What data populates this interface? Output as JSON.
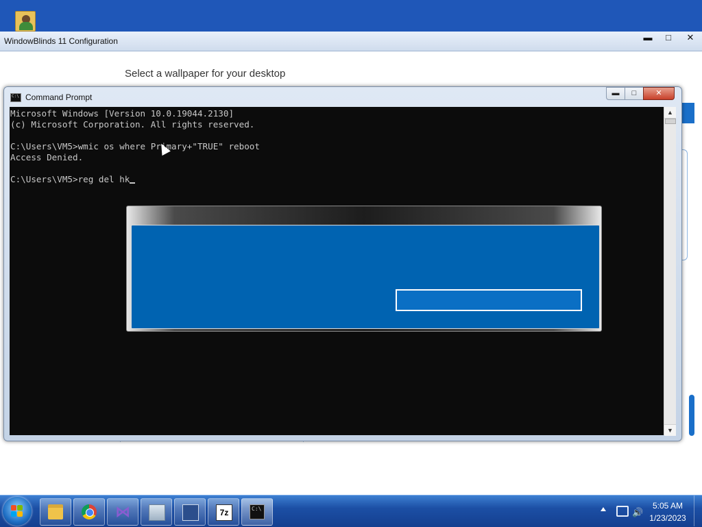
{
  "wb_window": {
    "title": "WindowBlinds 11 Configuration",
    "subtitle": "Select a wallpaper for your desktop",
    "minimize": "▬",
    "maximize": "□",
    "close": "✕"
  },
  "cmd_window": {
    "title": "Command Prompt",
    "minimize": "▬",
    "maximize": "□",
    "close": "✕",
    "lines": [
      "Microsoft Windows [Version 10.0.19044.2130]",
      "(c) Microsoft Corporation. All rights reserved.",
      "",
      "C:\\Users\\VM5>wmic os where Primary+\"TRUE\" reboot",
      "Access Denied.",
      "",
      "C:\\Users\\VM5>reg del hk"
    ]
  },
  "scroll": {
    "up": "▲",
    "down": "▼"
  },
  "taskbar": {
    "icons": [
      "start-orb",
      "file-explorer",
      "chrome",
      "visual-studio",
      "photo-viewer",
      "paint-tool",
      "7zip",
      "command-prompt"
    ],
    "sevenzip_label": "7z",
    "cmd_label": "C:\\"
  },
  "tray": {
    "volume_icon": "🔊",
    "time": "5:05 AM",
    "date": "1/23/2023"
  },
  "colors": {
    "accent": "#0063b1",
    "desktop": "#1f57b8",
    "console_bg": "#0c0c0c",
    "console_text": "#c8c8c8"
  }
}
